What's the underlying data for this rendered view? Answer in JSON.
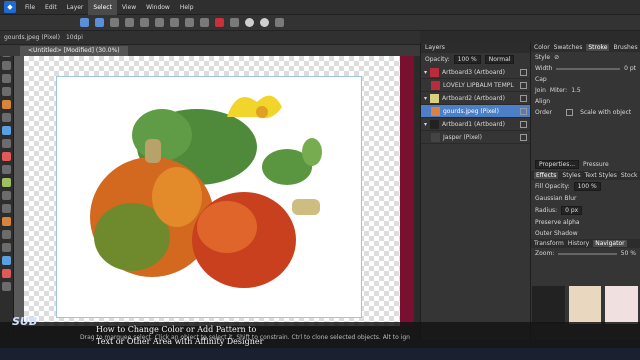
{
  "menubar": {
    "items": [
      "File",
      "Edit",
      "Layer",
      "Select",
      "View",
      "Window",
      "Help"
    ],
    "active": "Select"
  },
  "context": {
    "filename": "gourds.jpeg (Pixel)",
    "dpi": "10dpi"
  },
  "document": {
    "tab": "<Untitled> [Modified] (30.0%)"
  },
  "layers": {
    "tabs": "Layers",
    "opacity_label": "Opacity:",
    "opacity_value": "100 %",
    "blend": "Normal",
    "rows": [
      {
        "name": "Artboard3 (Artboard)"
      },
      {
        "name": "LOVELY LIPBALM TEMPL"
      },
      {
        "name": "Artboard2 (Artboard)"
      },
      {
        "name": "gourds.jpeg (Pixel)"
      },
      {
        "name": "Artboard1 (Artboard)"
      },
      {
        "name": "Jasper (Pixel)"
      }
    ]
  },
  "props": {
    "tabs": [
      "Color",
      "Swatches",
      "Stroke",
      "Brushes"
    ],
    "style_label": "Style",
    "width_label": "Width",
    "width_value": "0 pt",
    "cap_label": "Cap",
    "join_label": "Join",
    "miter_label": "Miter:",
    "miter_value": "1.5",
    "align_label": "Align",
    "order_label": "Order",
    "scale_label": "Scale with object",
    "properties_label": "Properties...",
    "pressure_label": "Pressure",
    "effects_tabs": [
      "Effects",
      "Styles",
      "Text Styles",
      "Stock"
    ],
    "fill_opacity_label": "Fill Opacity:",
    "fill_opacity_value": "100 %",
    "gaussian": "Gaussian Blur",
    "radius_label": "Radius:",
    "radius_value": "0 px",
    "preserve": "Preserve alpha",
    "outer_shadow": "Outer Shadow",
    "nav_tabs": [
      "Transform",
      "History",
      "Navigator"
    ],
    "zoom_label": "Zoom:",
    "zoom_value": "50 %"
  },
  "status": {
    "text": "Drag to marquee select. Click an object to select it. Shift to constrain. Ctrl to clone selected objects. Alt to ignore snapping."
  },
  "caption": {
    "line1": "How to Change Color or Add Pattern to",
    "line2": "Text or Other Area with Affinity Designer"
  },
  "logo": {
    "text": "SUB"
  }
}
